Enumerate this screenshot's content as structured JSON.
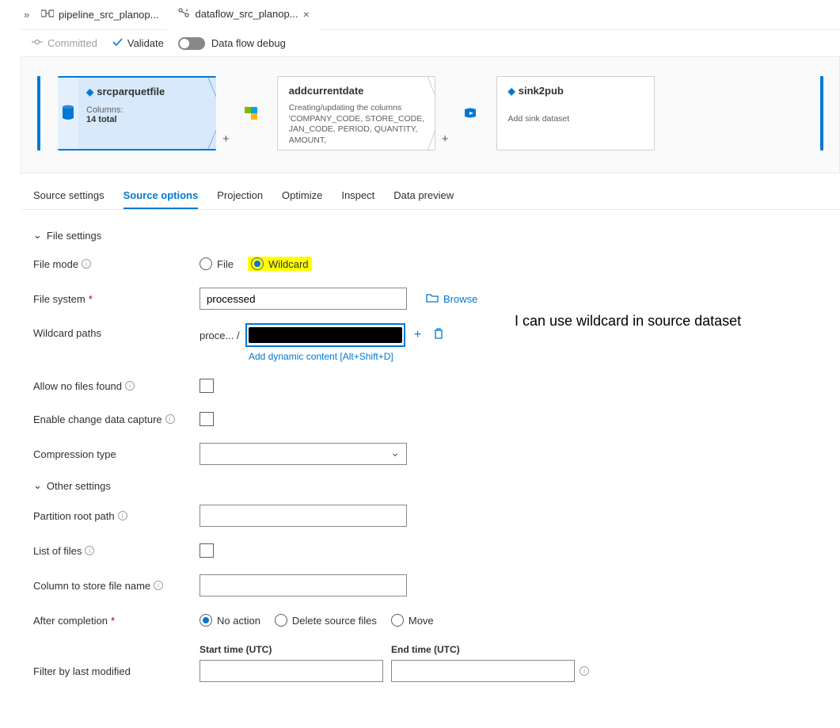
{
  "tabs": {
    "prev": "pipeline_src_planop...",
    "active": "dataflow_src_planop..."
  },
  "toolbar": {
    "committed": "Committed",
    "validate": "Validate",
    "debug": "Data flow debug"
  },
  "graph": {
    "node1": {
      "title": "srcparquetfile",
      "columns_label": "Columns:",
      "columns_value": "14 total"
    },
    "node2": {
      "title": "addcurrentdate",
      "desc": "Creating/updating the columns 'COMPANY_CODE, STORE_CODE, JAN_CODE, PERIOD, QUANTITY, AMOUNT,"
    },
    "node3": {
      "title": "sink2pub",
      "desc": "Add sink dataset"
    }
  },
  "inner_tabs": {
    "t1": "Source settings",
    "t2": "Source options",
    "t3": "Projection",
    "t4": "Optimize",
    "t5": "Inspect",
    "t6": "Data preview"
  },
  "form": {
    "section1": "File settings",
    "file_mode_label": "File mode",
    "file_mode_opt1": "File",
    "file_mode_opt2": "Wildcard",
    "file_system_label": "File system",
    "file_system_value": "processed",
    "browse": "Browse",
    "wildcard_paths_label": "Wildcard paths",
    "wildcard_prefix": "proce... /",
    "dyn_link": "Add dynamic content [Alt+Shift+D]",
    "allow_no_files": "Allow no files found",
    "enable_cdc": "Enable change data capture",
    "compression": "Compression type",
    "section2": "Other settings",
    "partition_root": "Partition root path",
    "list_of_files": "List of files",
    "col_store": "Column to store file name",
    "after_completion": "After completion",
    "ac_opt1": "No action",
    "ac_opt2": "Delete source files",
    "ac_opt3": "Move",
    "start_time": "Start time (UTC)",
    "end_time": "End time (UTC)",
    "filter_mod": "Filter by last modified"
  },
  "annotation": "I can use wildcard in source dataset"
}
